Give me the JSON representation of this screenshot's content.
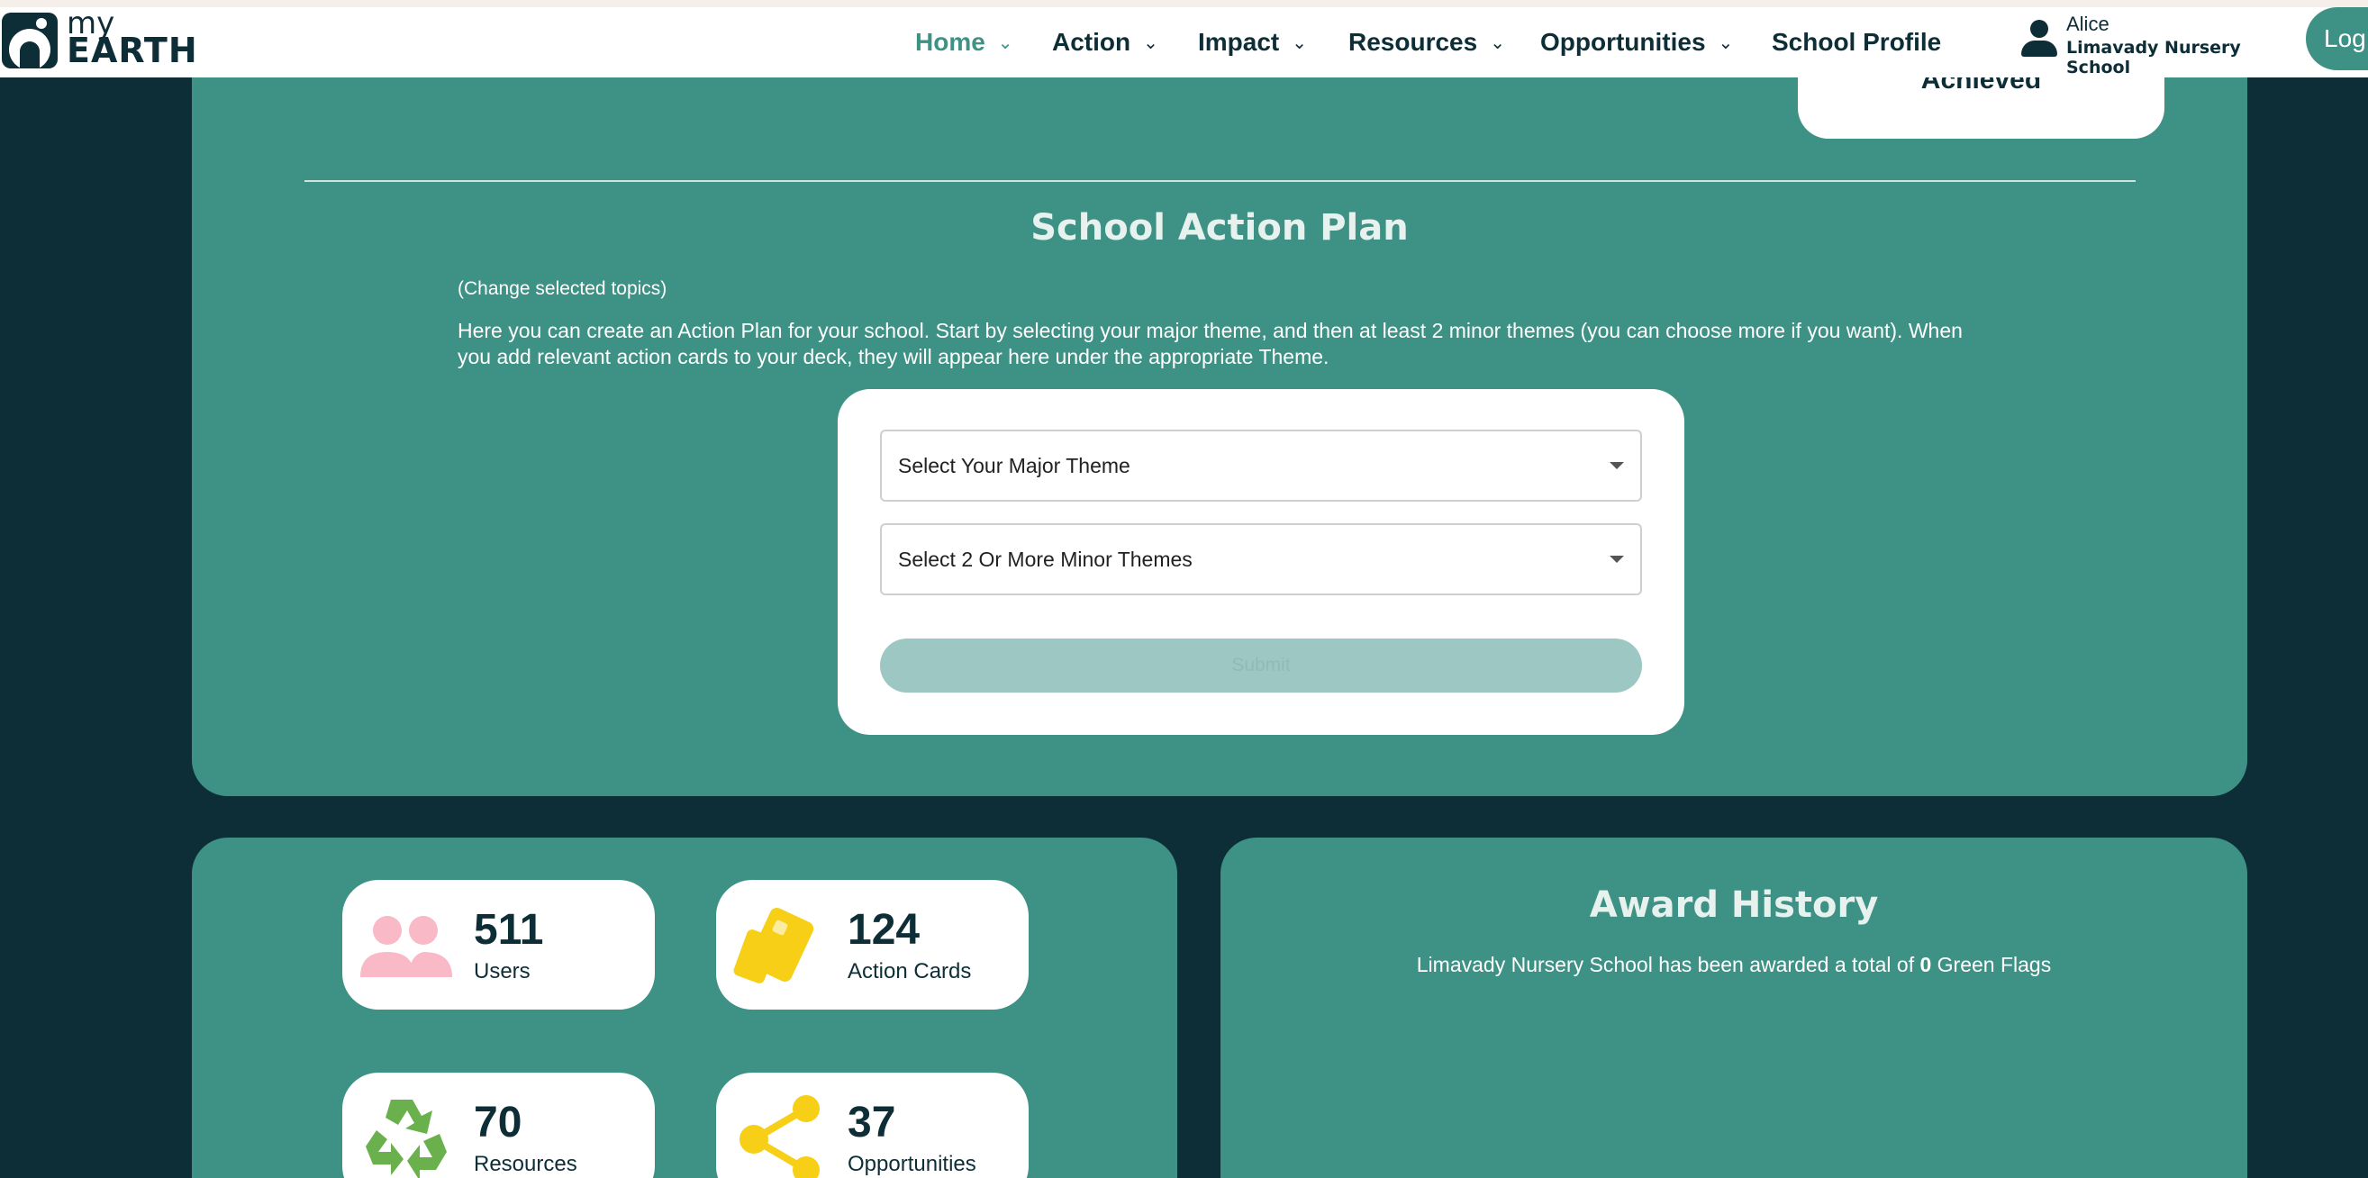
{
  "brand": {
    "my": "my",
    "earth": "EARTH"
  },
  "nav": {
    "home": "Home",
    "action": "Action",
    "impact": "Impact",
    "resources": "Resources",
    "opportunities": "Opportunities",
    "school_profile": "School Profile",
    "chevron": "⌄"
  },
  "user": {
    "name": "Alice",
    "school": "Limavady Nursery School"
  },
  "login_label": "Log",
  "achieved_label": "Achieved",
  "action_plan": {
    "title": "School Action Plan",
    "change_topics": "(Change selected topics)",
    "description": "Here you can create an Action Plan for your school. Start by selecting your major theme, and then at least 2 minor themes (you can choose more if you want). When you add relevant action cards to your deck, they will appear here under the appropriate Theme.",
    "major_placeholder": "Select Your Major Theme",
    "minor_placeholder": "Select 2 Or More Minor Themes",
    "submit_label": "Submit"
  },
  "stats": [
    {
      "value": "511",
      "label": "Users",
      "icon": "users-icon",
      "color": "#f9b9c6"
    },
    {
      "value": "124",
      "label": "Action Cards",
      "icon": "cards-icon",
      "color": "#f7cf16"
    },
    {
      "value": "70",
      "label": "Resources",
      "icon": "recycle-icon",
      "color": "#6ab14e"
    },
    {
      "value": "37",
      "label": "Opportunities",
      "icon": "share-icon",
      "color": "#f7cf16"
    }
  ],
  "award": {
    "title": "Award History",
    "text_prefix": "Limavady Nursery School has been awarded a total of",
    "count": "0",
    "text_suffix": "Green Flags"
  },
  "colors": {
    "teal": "#3e9185",
    "navy": "#0d2d37"
  }
}
